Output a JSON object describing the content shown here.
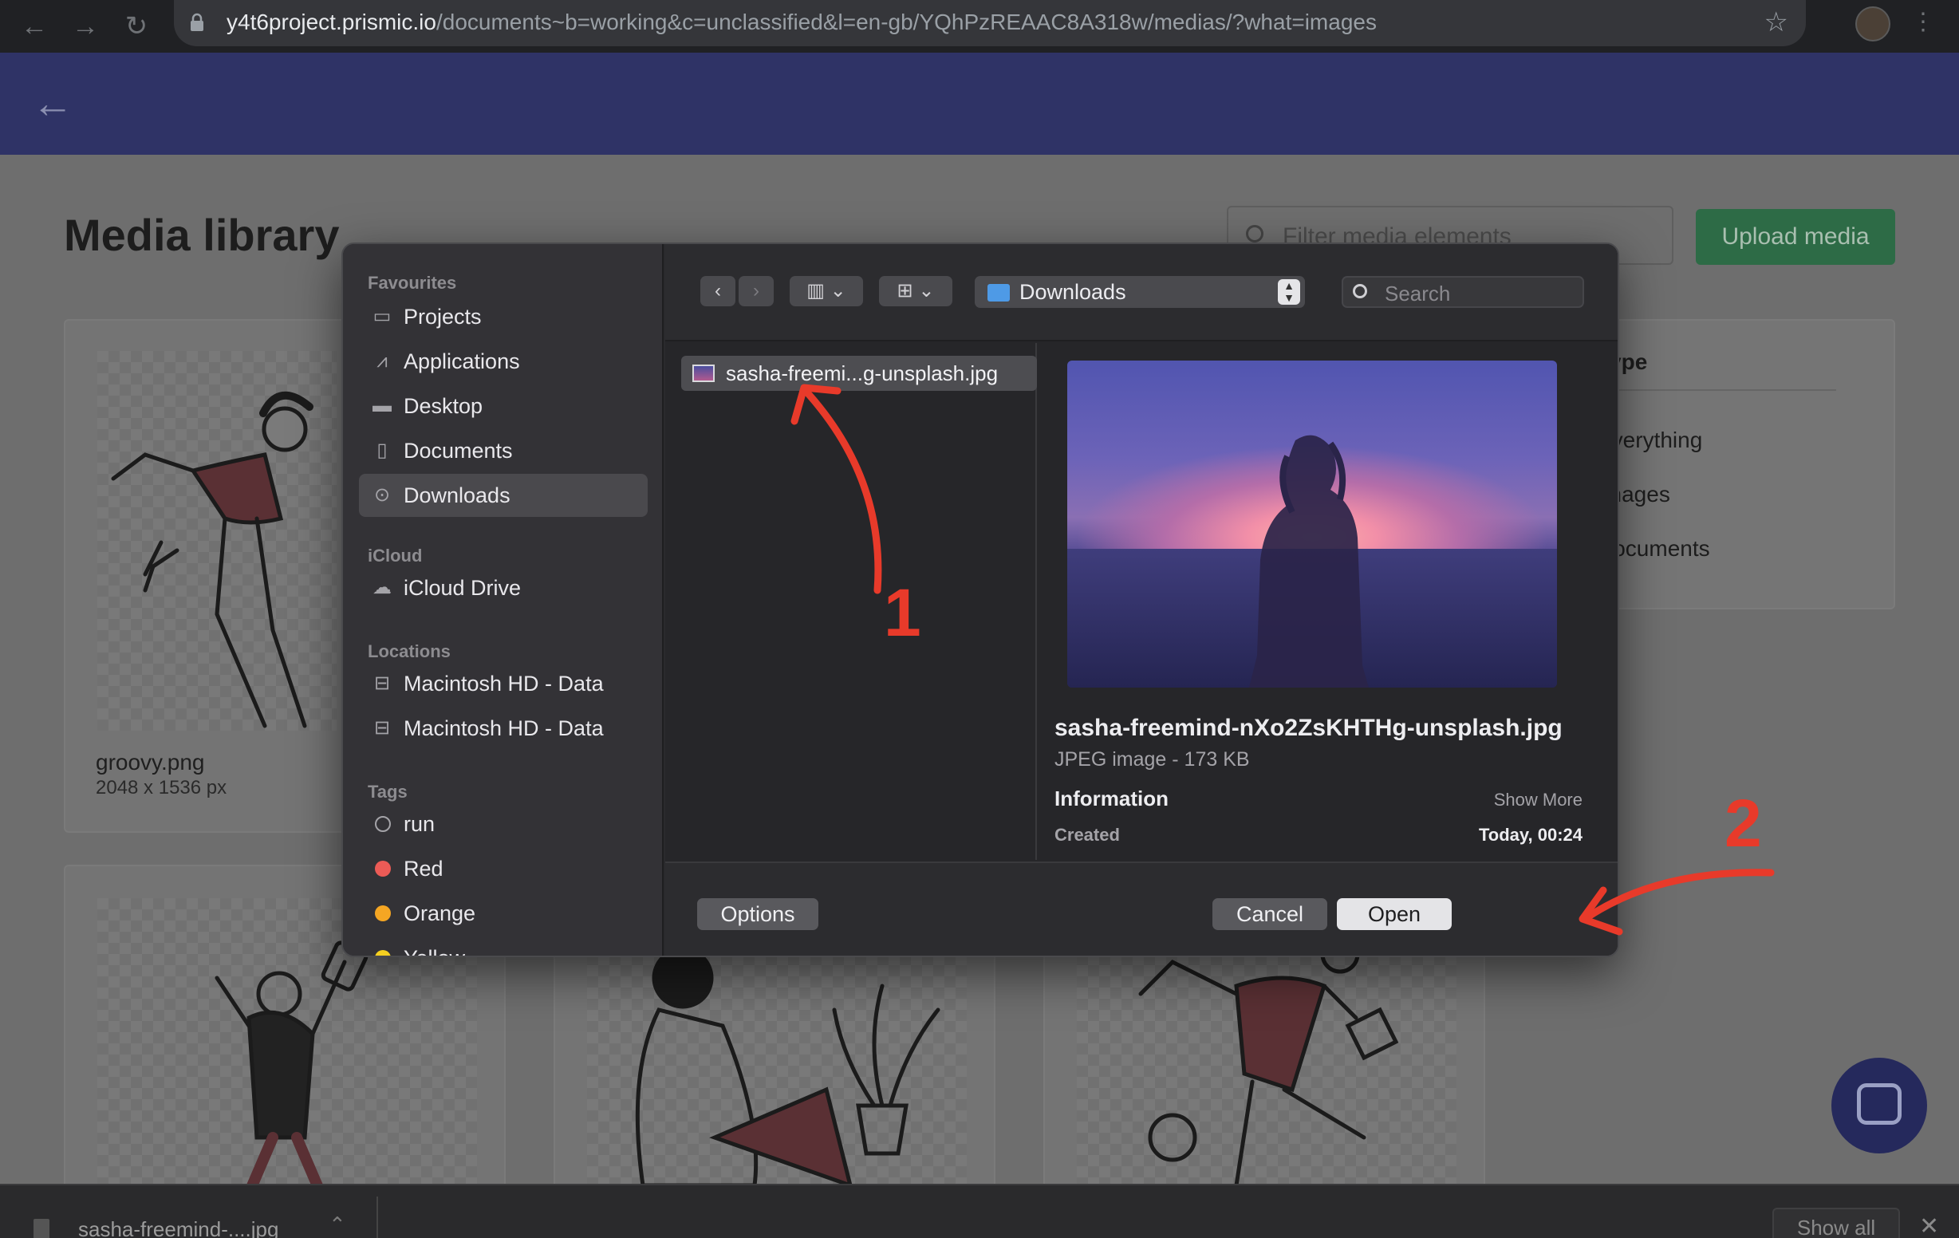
{
  "browser": {
    "url_host": "y4t6project.prismic.io",
    "url_path": "/documents~b=working&c=unclassified&l=en-gb/YQhPzREAAC8A318w/medias/?what=images"
  },
  "app": {
    "page_title": "Media library",
    "filter_placeholder": "Filter media elements",
    "upload_label": "Upload media",
    "card": {
      "name": "groovy.png",
      "dims": "2048 x 1536 px"
    },
    "type_panel": {
      "heading": "Type",
      "options": [
        "Everything",
        "Images",
        "Documents"
      ]
    }
  },
  "dialog": {
    "sidebar": {
      "favourites_heading": "Favourites",
      "favourites": [
        {
          "label": "Projects",
          "icon": "folder-icon"
        },
        {
          "label": "Applications",
          "icon": "applications-icon"
        },
        {
          "label": "Desktop",
          "icon": "desktop-icon"
        },
        {
          "label": "Documents",
          "icon": "document-icon"
        },
        {
          "label": "Downloads",
          "icon": "download-icon",
          "selected": true
        }
      ],
      "icloud_heading": "iCloud",
      "icloud": [
        {
          "label": "iCloud Drive",
          "icon": "cloud-icon"
        }
      ],
      "locations_heading": "Locations",
      "locations": [
        {
          "label": "Macintosh HD - Data",
          "icon": "disk-icon"
        },
        {
          "label": "Macintosh HD - Data",
          "icon": "disk-icon"
        }
      ],
      "tags_heading": "Tags",
      "tags": [
        {
          "label": "run",
          "color": ""
        },
        {
          "label": "Red",
          "color": "#ec5b56"
        },
        {
          "label": "Orange",
          "color": "#f5a623"
        },
        {
          "label": "Yellow",
          "color": "#f5d020"
        }
      ]
    },
    "toolbar": {
      "location": "Downloads",
      "search_placeholder": "Search"
    },
    "file_item": "sasha-freemi...g-unsplash.jpg",
    "preview": {
      "filename": "sasha-freemind-nXo2ZsKHTHg-unsplash.jpg",
      "kind": "JPEG image - 173 KB",
      "info_label": "Information",
      "show_more": "Show More",
      "created_label": "Created",
      "created_value": "Today, 00:24"
    },
    "buttons": {
      "options": "Options",
      "cancel": "Cancel",
      "open": "Open"
    }
  },
  "annotations": {
    "step1": "1",
    "step2": "2",
    "color": "#e83a2a"
  },
  "download_bar": {
    "file": "sasha-freemind-....jpg",
    "show_all": "Show all"
  }
}
